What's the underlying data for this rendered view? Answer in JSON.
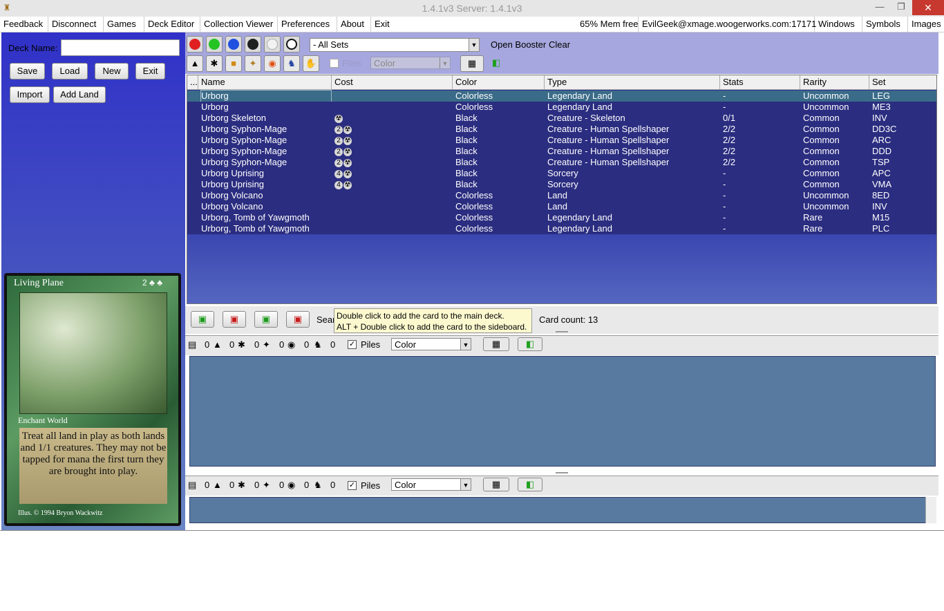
{
  "window": {
    "title": "1.4.1v3   Server: 1.4.1v3",
    "app_icon": "wizard-icon",
    "minimize_glyph": "—",
    "restore_glyph": "❐",
    "close_glyph": "✕"
  },
  "menu": {
    "items": [
      "Feedback",
      "Disconnect",
      "Games",
      "Deck Editor",
      "Collection Viewer",
      "Preferences",
      "About",
      "Exit"
    ],
    "mem": "65% Mem free",
    "server": "EvilGeek@xmage.woogerworks.com:17171",
    "right_items": [
      "Windows",
      "Symbols",
      "Images"
    ]
  },
  "deck_panel": {
    "deck_name_label": "Deck Name:",
    "deck_name_value": "",
    "buttons": {
      "save": "Save",
      "load": "Load",
      "new": "New",
      "exit": "Exit",
      "import": "Import",
      "add_land": "Add Land"
    }
  },
  "card_preview": {
    "name": "Living Plane",
    "cost": "2 ♣ ♣",
    "type_line": "Enchant World",
    "text": "Treat all land in play as both lands and 1/1 creatures. They may not be tapped for mana the first turn they are brought into play.",
    "illus": "Illus. © 1994 Bryon Wackwitz"
  },
  "filters": {
    "mana_colors": [
      {
        "name": "red",
        "color": "#e02020"
      },
      {
        "name": "green",
        "color": "#25c425"
      },
      {
        "name": "blue",
        "color": "#2050e0"
      },
      {
        "name": "black",
        "color": "#202020"
      },
      {
        "name": "white",
        "color": "#f2f2f2"
      },
      {
        "name": "colorless",
        "color": "#ffffff"
      }
    ],
    "type_icons": [
      "land-icon",
      "creature-icon",
      "artifact-icon",
      "sorcery-icon",
      "instant-icon",
      "planeswalker-icon",
      "enchantment-icon"
    ],
    "set_select": "- All Sets",
    "open_booster": "Open Booster",
    "clear": "Clear",
    "piles_label": "Piles",
    "sort_select": "Color"
  },
  "table": {
    "columns": [
      "...",
      "Name",
      "Cost",
      "Color",
      "Type",
      "Stats",
      "Rarity",
      "Set"
    ],
    "rows": [
      {
        "name": "Urborg",
        "cost": [],
        "color": "Colorless",
        "type": "Legendary Land",
        "stats": "-",
        "rarity": "Uncommon",
        "set": "LEG"
      },
      {
        "name": "Urborg",
        "cost": [],
        "color": "Colorless",
        "type": "Legendary Land",
        "stats": "-",
        "rarity": "Uncommon",
        "set": "ME3"
      },
      {
        "name": "Urborg Skeleton",
        "cost": [
          "☢"
        ],
        "color": "Black",
        "type": "Creature - Skeleton",
        "stats": "0/1",
        "rarity": "Common",
        "set": "INV"
      },
      {
        "name": "Urborg Syphon-Mage",
        "cost": [
          "2",
          "☢"
        ],
        "color": "Black",
        "type": "Creature - Human Spellshaper",
        "stats": "2/2",
        "rarity": "Common",
        "set": "DD3C"
      },
      {
        "name": "Urborg Syphon-Mage",
        "cost": [
          "2",
          "☢"
        ],
        "color": "Black",
        "type": "Creature - Human Spellshaper",
        "stats": "2/2",
        "rarity": "Common",
        "set": "ARC"
      },
      {
        "name": "Urborg Syphon-Mage",
        "cost": [
          "2",
          "☢"
        ],
        "color": "Black",
        "type": "Creature - Human Spellshaper",
        "stats": "2/2",
        "rarity": "Common",
        "set": "DDD"
      },
      {
        "name": "Urborg Syphon-Mage",
        "cost": [
          "2",
          "☢"
        ],
        "color": "Black",
        "type": "Creature - Human Spellshaper",
        "stats": "2/2",
        "rarity": "Common",
        "set": "TSP"
      },
      {
        "name": "Urborg Uprising",
        "cost": [
          "4",
          "☢"
        ],
        "color": "Black",
        "type": "Sorcery",
        "stats": "-",
        "rarity": "Common",
        "set": "APC"
      },
      {
        "name": "Urborg Uprising",
        "cost": [
          "4",
          "☢"
        ],
        "color": "Black",
        "type": "Sorcery",
        "stats": "-",
        "rarity": "Common",
        "set": "VMA"
      },
      {
        "name": "Urborg Volcano",
        "cost": [],
        "color": "Colorless",
        "type": "Land",
        "stats": "-",
        "rarity": "Uncommon",
        "set": "8ED"
      },
      {
        "name": "Urborg Volcano",
        "cost": [],
        "color": "Colorless",
        "type": "Land",
        "stats": "-",
        "rarity": "Uncommon",
        "set": "INV"
      },
      {
        "name": "Urborg, Tomb of Yawgmoth",
        "cost": [],
        "color": "Colorless",
        "type": "Legendary Land",
        "stats": "-",
        "rarity": "Rare",
        "set": "M15"
      },
      {
        "name": "Urborg, Tomb of Yawgmoth",
        "cost": [],
        "color": "Colorless",
        "type": "Legendary Land",
        "stats": "-",
        "rarity": "Rare",
        "set": "PLC"
      }
    ]
  },
  "action_bar": {
    "search_label": "Sear",
    "tooltip_line1": "Double click to add the card to the main deck.",
    "tooltip_line2": "ALT + Double click to add the card to the sideboard.",
    "card_count": "Card count:  13"
  },
  "main_deck": {
    "counts": [
      "0",
      "0",
      "0",
      "0",
      "0",
      "0"
    ],
    "piles_label": "Piles",
    "sort_select": "Color"
  },
  "sideboard": {
    "counts": [
      "0",
      "0",
      "0",
      "0",
      "0",
      "0"
    ],
    "piles_label": "Piles",
    "sort_select": "Color"
  }
}
